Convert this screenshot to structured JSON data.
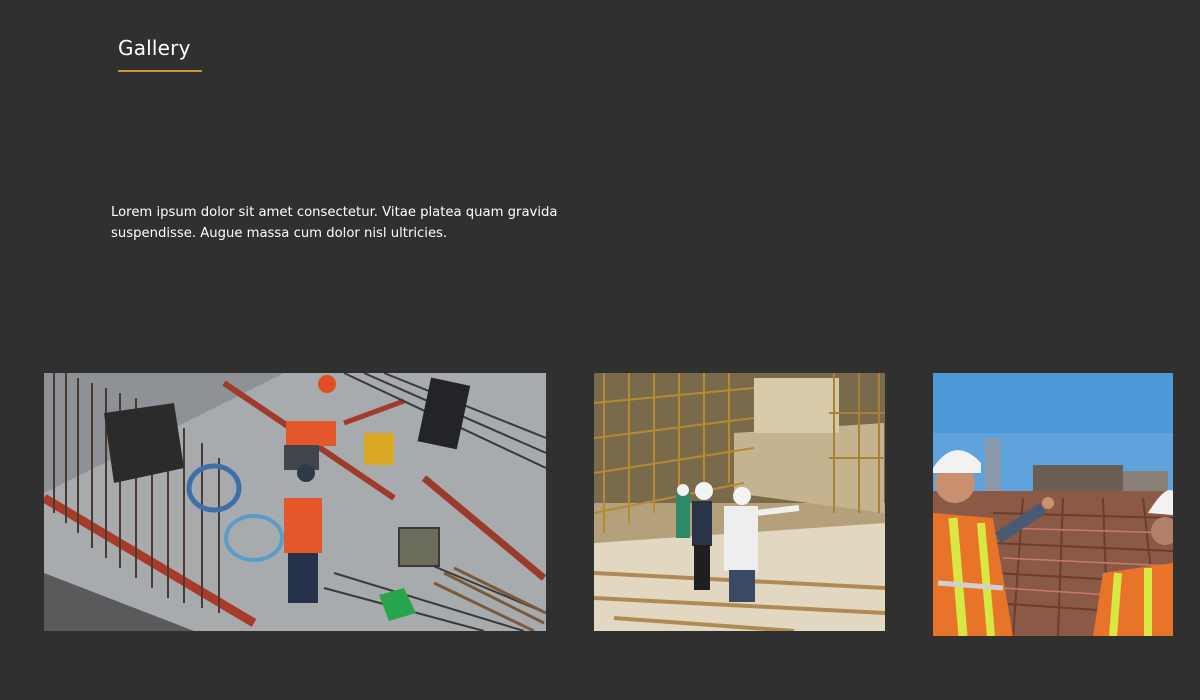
{
  "gallery": {
    "title": "Gallery",
    "accent_color": "#c9962f",
    "intro": "Lorem ipsum dolor sit amet consectetur. Vitae platea quam gravida suspendisse. Augue massa cum dolor nisl ultricies.",
    "photos": [
      {
        "name": "construction-site-rebar-workers-photo"
      },
      {
        "name": "construction-site-scaffolding-photo"
      },
      {
        "name": "construction-engineers-site-view-photo"
      }
    ]
  },
  "colors": {
    "background": "#303030",
    "text": "#ffffff"
  }
}
